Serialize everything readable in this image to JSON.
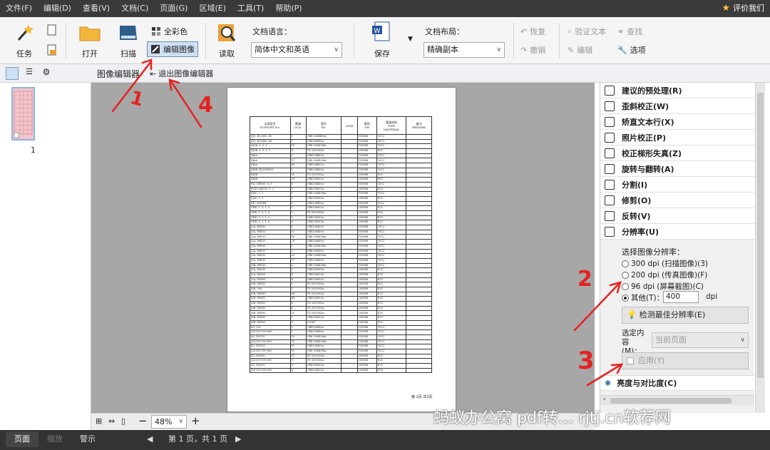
{
  "menu": [
    "文件(F)",
    "编辑(D)",
    "查看(V)",
    "文档(C)",
    "页面(G)",
    "区域(E)",
    "工具(T)",
    "帮助(P)"
  ],
  "menu_right": "评价我们",
  "ribbon": {
    "task": "任务",
    "open": "打开",
    "scan": "扫描",
    "full_color": "全彩色",
    "edit_image": "编辑图像",
    "read": "读取",
    "doc_lang_label": "文档语言：",
    "doc_lang_value": "简体中文和英语",
    "save": "保存",
    "doc_layout_label": "文档布局：",
    "doc_layout_value": "精确副本",
    "word_icon_text": "DOCX",
    "undo": "恢复",
    "redo": "撤销",
    "verify_text": "验证文本",
    "edit": "编辑",
    "find": "查找",
    "options": "选项"
  },
  "second_bar": {
    "title": "图像编辑器",
    "exit": "退出图像编辑器"
  },
  "thumbnail": {
    "page_number": "1"
  },
  "document": {
    "headers": [
      "支架型号\nSUPPORT No.",
      "数量\nQUA.",
      "管号\nNo.",
      "LINE",
      "管径\nDN",
      "管道材料\nPIPE\nMATERIAL",
      "备注\nREMARK"
    ],
    "rows": [
      [
        "DJ1, EL2880, 40",
        "1",
        "CB8-2064400a-",
        "150MM",
        "15C2"
      ],
      [
        "DJ1, EL2880, 40",
        "1",
        "CB8208400a-",
        "150MM",
        "15C2"
      ],
      [
        "DJ2B, 0, 0, 3",
        "10",
        "CB6-2064008a-",
        "150MM",
        "15C2"
      ],
      [
        "DJ2B, 0, 0, 2, 0",
        "4",
        "TS-2050003a-",
        "200MM",
        "E2C"
      ],
      [
        "DJ6A",
        "1",
        "CB8204400a-",
        "150MM",
        "15C2"
      ],
      [
        "DJ6A",
        "17",
        "CB6-2064008a-",
        "150MM",
        "15C2"
      ],
      [
        "DJ6A",
        "49",
        "CB8204600a-",
        "150MM",
        "15C2"
      ],
      [
        "DJ6B, EL2680800",
        "1",
        "CB8204600a-",
        "150MM",
        "15C2"
      ],
      [
        "DJ6B",
        "51",
        "TS-2050002a-",
        "200MM",
        "E2C"
      ],
      [
        "DJ6B",
        "29",
        "CB8206003a-",
        "200MM",
        "E2C"
      ],
      [
        "FJ2, DB160, 0, 0",
        "1",
        "CB8206400a-",
        "150MM",
        "15C2"
      ],
      [
        "FJ2B, DB250, 1, 2",
        "1",
        "CB8206003a-",
        "200MM",
        "E2C"
      ],
      [
        "FJ6C, 1, 2",
        "1",
        "CB8-2064008a-",
        "150MM",
        "15C2"
      ],
      [
        "FJ6C, 1, 2",
        "1",
        "CB8206003a-",
        "200MM",
        "E2C"
      ],
      [
        "GD, 200MM",
        "1",
        "CB8206400a-",
        "150MM",
        "15C2"
      ],
      [
        "GHD, 1, 0, 1, 0",
        "1",
        "CB8206003a-",
        "200MM",
        "E2C"
      ],
      [
        "GHD, 1, 0, 1, 0",
        "1",
        "TS-2050005a-",
        "200MM",
        "E2C"
      ],
      [
        "GHD, 1, 2, 1, 0",
        "3",
        "CB8206003a-",
        "200MM",
        "E2C"
      ],
      [
        "GHD, 1, 2, 1, 0",
        "6",
        "CB8206003a-",
        "200MM",
        "E2C"
      ],
      [
        "J3A, DB300",
        "1",
        "CB8206400a-",
        "150MM",
        "15C2"
      ],
      [
        "J3A, DB150",
        "12",
        "CB8206400a-",
        "150MM",
        "15C2"
      ],
      [
        "J3A, DB150",
        "66",
        "CB8-2064008a-",
        "150MM",
        "15C2"
      ],
      [
        "J3A, DB150",
        "76",
        "CB8206400a-",
        "150MM",
        "15C2"
      ],
      [
        "J3A, DB150",
        "1",
        "CB8-2064008a-",
        "150MM",
        "15C2"
      ],
      [
        "J3A, DB150",
        "2",
        "CB8206400a-",
        "150MM",
        "15C2"
      ],
      [
        "J3A, DB150",
        "25",
        "CB8-2064008a-",
        "150MM",
        "15C2"
      ],
      [
        "J3A, DB150",
        "27",
        "CB8206400a-",
        "150MM",
        "15C2"
      ],
      [
        "J3B, DB150",
        "2",
        "CB8-2064008a-",
        "150MM",
        "15C2"
      ],
      [
        "J5A, DB250",
        "1",
        "CB8206003a-",
        "200MM",
        "E2C"
      ],
      [
        "J5A, DB250",
        "4",
        "CB8206003a-",
        "200MM",
        "E2C"
      ],
      [
        "J5A, DB300",
        "4",
        "CB8206003a-",
        "200MM",
        "E2C"
      ],
      [
        "J5B, DB300",
        "1",
        "TS-2050003a-",
        "200MM",
        "E2C"
      ],
      [
        "J5B, 300",
        "1",
        "TS-2050003a-",
        "200MM",
        "E2C"
      ],
      [
        "J5B, DB300",
        "66",
        "TS-2050002a-",
        "200MM",
        "E2C"
      ],
      [
        "J6B, DB300",
        "44",
        "CB8206003a-",
        "200MM",
        "E2C"
      ],
      [
        "J6B, DB300",
        "4",
        "TS-2050002a-",
        "200MM",
        "E2C"
      ],
      [
        "J6B, DB300",
        "4",
        "TS-2050002a-",
        "200MM",
        "E2C"
      ],
      [
        "J6B, DB300",
        "10",
        "TS-2050003a-",
        "200MM",
        "E2C"
      ],
      [
        "J6B, DB300",
        "1",
        "CB8206003a-",
        "200MM",
        "E2C"
      ],
      [
        "J6B, DB300",
        "1",
        "L5061-",
        "200MM",
        "E2C"
      ],
      [
        "K3, 150",
        "1",
        "CB8206400a-",
        "150MM",
        "15C2"
      ],
      [
        "J24-100-150-600",
        "1",
        "CB8206400a-",
        "150MM",
        "15C2"
      ],
      [
        "K3, DN150",
        "10",
        "CB8-2064008a-",
        "150MM",
        "15C2"
      ],
      [
        "J24-100-150-600",
        "10",
        "CB8-2064008a-",
        "150MM",
        "15C2"
      ],
      [
        "K3, DN150",
        "11",
        "CB8206400a-",
        "150MM",
        "15C2"
      ],
      [
        "J24-100-150-600",
        "11",
        "CB8-2064008a-",
        "150MM",
        "15C2"
      ],
      [
        "K3, DN300",
        "11",
        "TS-2050003a-",
        "200MM",
        "E2C"
      ],
      [
        "J24-200-150-600",
        "5",
        "TS-2050002a-",
        "200MM",
        "E2C"
      ],
      [
        "K3, DN300",
        "8",
        "CB8206003a-",
        "200MM",
        "E2C"
      ],
      [
        "J24-200-150-600",
        "8",
        "CB8206003a-",
        "200MM",
        "E2C"
      ]
    ],
    "footer": "第 2页 共2页"
  },
  "right_panel": {
    "items": [
      {
        "label": "建议的预处理(R)",
        "icon": "gear-icon"
      },
      {
        "label": "歪斜校正(W)",
        "icon": "deskew-icon"
      },
      {
        "label": "矫直文本行(X)",
        "icon": "straighten-icon"
      },
      {
        "label": "照片校正(P)",
        "icon": "camera-icon"
      },
      {
        "label": "校正梯形失真(Z)",
        "icon": "trapezoid-icon"
      },
      {
        "label": "旋转与翻转(A)",
        "icon": "rotate-icon"
      },
      {
        "label": "分割(I)",
        "icon": "split-icon"
      },
      {
        "label": "修剪(O)",
        "icon": "crop-icon"
      },
      {
        "label": "反转(V)",
        "icon": "invert-icon"
      },
      {
        "label": "分辨率(U)",
        "icon": "resolution-icon"
      }
    ],
    "resolution_label": "选择图像分辨率：",
    "options": [
      "300 dpi (扫描图像)(3)",
      "200 dpi (传真图像)(F)",
      "96 dpi (屏幕截图)(C)",
      "其他(T)："
    ],
    "other_value": "400",
    "dpi_unit": "dpi",
    "detect_button": "检测最佳分辨率(E)",
    "select_content_label": "选定内容(M)：",
    "select_content_value": "当前页面",
    "apply_button": "应用(Y)",
    "brightness_item": "亮度与对比度(C)"
  },
  "zoom": {
    "value": "48%"
  },
  "status": {
    "tab_page": "页面",
    "tab_zoom": "缩放",
    "tab_warn": "警示",
    "page_info": "第 1 页，共 1 页"
  },
  "annotations": [
    "1",
    "2",
    "3",
    "4"
  ],
  "watermark": "蚂蚁办公窝 pdf转… rjtj.cn软荐网",
  "colors": {
    "annotation": "#e52222",
    "menubar": "#3a3a3a",
    "thumb_selected": "#f3c6cc"
  }
}
